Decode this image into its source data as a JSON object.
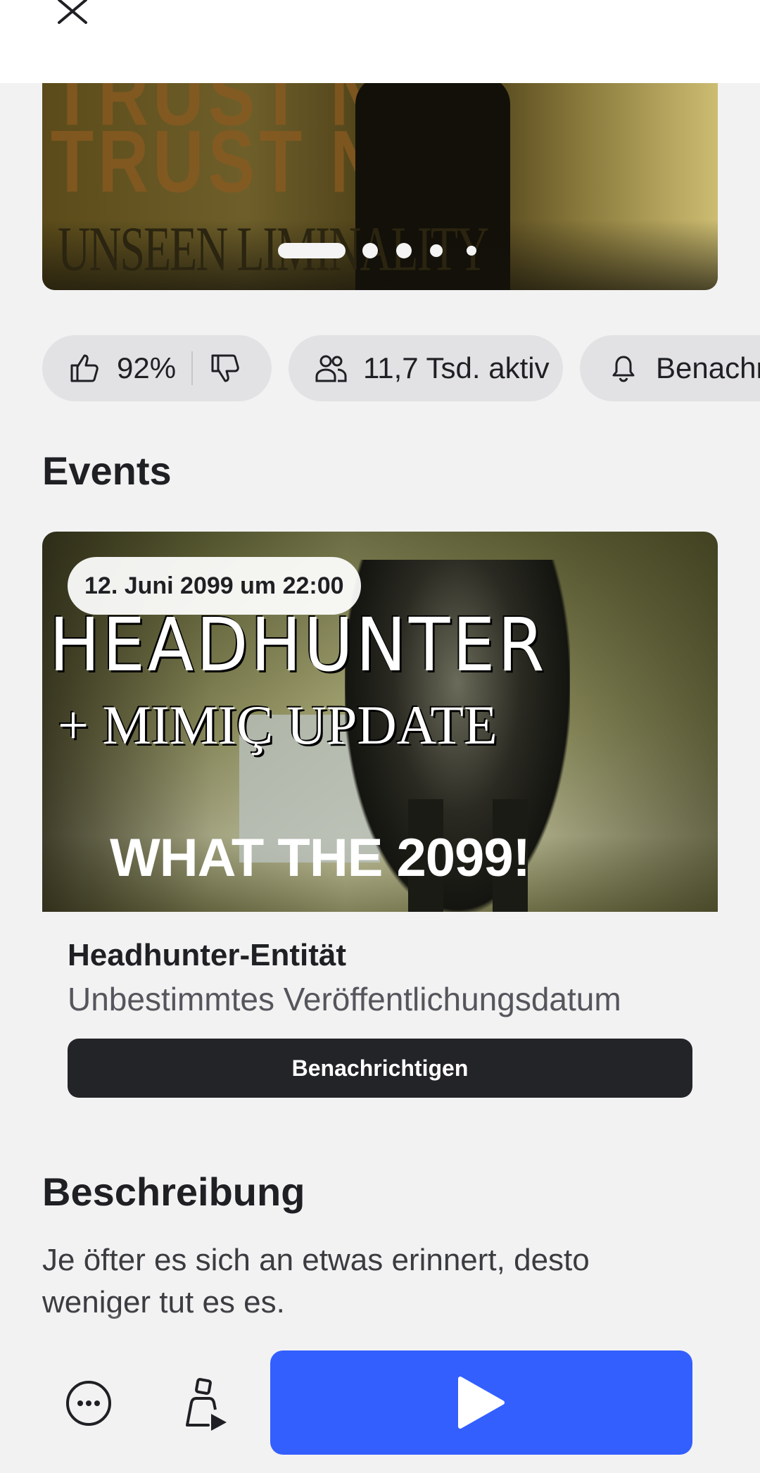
{
  "header": {
    "close_icon": "close-icon"
  },
  "hero": {
    "art_text_line1": "TRUST NO",
    "art_text_line2": "TRUST NO",
    "art_text_logo": "UNSEEN LIMINALITY",
    "carousel_pages": 5,
    "carousel_active_index": 0
  },
  "stats": {
    "rating": "92%",
    "like_icon": "thumbs-up-icon",
    "dislike_icon": "thumbs-down-icon",
    "active_players": "11,7 Tsd. aktiv",
    "players_icon": "people-icon",
    "notify_label": "Benachr",
    "notify_icon": "bell-icon"
  },
  "events": {
    "heading": "Events",
    "date_badge": "12. Juni 2099 um 22:00",
    "image_title_1": "HEADHUNTER",
    "image_title_2": "+ MIMIÇ UPDATE",
    "image_title_3": "WHAT THE 2099!",
    "name": "Headhunter-Entität",
    "release": "Unbestimmtes Veröffentlichungsdatum",
    "notify_button": "Benachrichtigen"
  },
  "description": {
    "heading": "Beschreibung",
    "text": "Je öfter es sich an etwas erinnert, desto weniger tut es es."
  },
  "bottom_bar": {
    "more_icon": "more-options-icon",
    "avatar_icon": "avatar-play-icon",
    "play_icon": "play-icon",
    "accent_color": "#335fff"
  }
}
